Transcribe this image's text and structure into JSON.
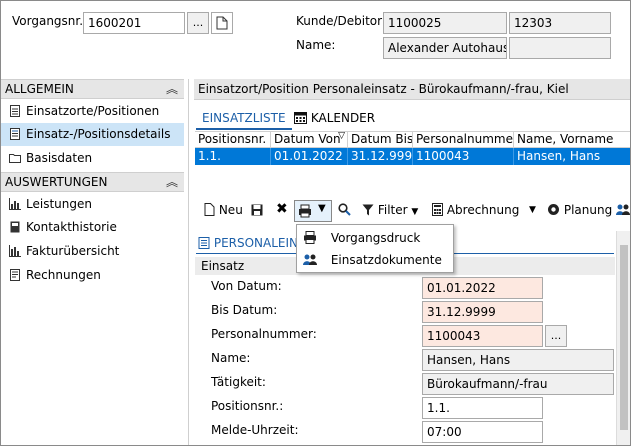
{
  "header": {
    "vorgang_label": "Vorgangsnr.:",
    "vorgang_value": "1600201",
    "browse_label": "...",
    "kunde_label": "Kunde/Debitor:",
    "kunde_nr": "1100025",
    "kunde_sub": "12303",
    "name_label": "Name:",
    "name_value": "Alexander Autohaus",
    "name_extra": ""
  },
  "sidebar": {
    "group1": "ALLGEMEIN",
    "items1": [
      {
        "label": "Einsatzorte/Positionen",
        "icon": "document-list-icon"
      },
      {
        "label": "Einsatz-/Positionsdetails",
        "icon": "details-list-icon",
        "selected": true
      },
      {
        "label": "Basisdaten",
        "icon": "folder-icon"
      }
    ],
    "group2": "AUSWERTUNGEN",
    "items2": [
      {
        "label": "Leistungen",
        "icon": "bar-chart-icon"
      },
      {
        "label": "Kontakthistorie",
        "icon": "address-book-icon"
      },
      {
        "label": "Fakturübersicht",
        "icon": "bar-chart-icon"
      },
      {
        "label": "Rechnungen",
        "icon": "receipt-icon"
      }
    ]
  },
  "main": {
    "title": "Einsatzort/Position Personaleinsatz - Bürokaufmann/-frau, Kiel",
    "tabs": [
      "EINSATZLISTE",
      "KALENDER"
    ],
    "columns": [
      "Positionsnr.",
      "Datum Von",
      "Datum Bis",
      "Personalnummer",
      "Name, Vorname"
    ],
    "rows": [
      [
        "1.1.",
        "01.01.2022",
        "31.12.9999",
        "1100043",
        "Hansen, Hans"
      ]
    ]
  },
  "toolbar": {
    "neu": "Neu",
    "filter": "Filter",
    "abrechnung": "Abrechnung",
    "planung": "Planung"
  },
  "dropdown": {
    "items": [
      "Vorgangsdruck",
      "Einsatzdokumente"
    ]
  },
  "detail": {
    "section_title": "PERSONALEIN",
    "subsection": "Einsatz",
    "fields": [
      {
        "label": "Von Datum:",
        "value": "01.01.2022"
      },
      {
        "label": "Bis Datum:",
        "value": "31.12.9999"
      },
      {
        "label": "Personalnummer:",
        "value": "1100043"
      },
      {
        "label": "Name:",
        "value": "Hansen, Hans"
      },
      {
        "label": "Tätigkeit:",
        "value": "Bürokaufmann/-frau"
      },
      {
        "label": "Positionsnr.:",
        "value": "1.1."
      },
      {
        "label": "Melde-Uhrzeit:",
        "value": "07:00"
      }
    ]
  },
  "colors": {
    "selection": "#0078d7",
    "sidebar_selected": "#cce4f7",
    "required_field": "#fde8e0",
    "accent": "#1c5fa8"
  }
}
